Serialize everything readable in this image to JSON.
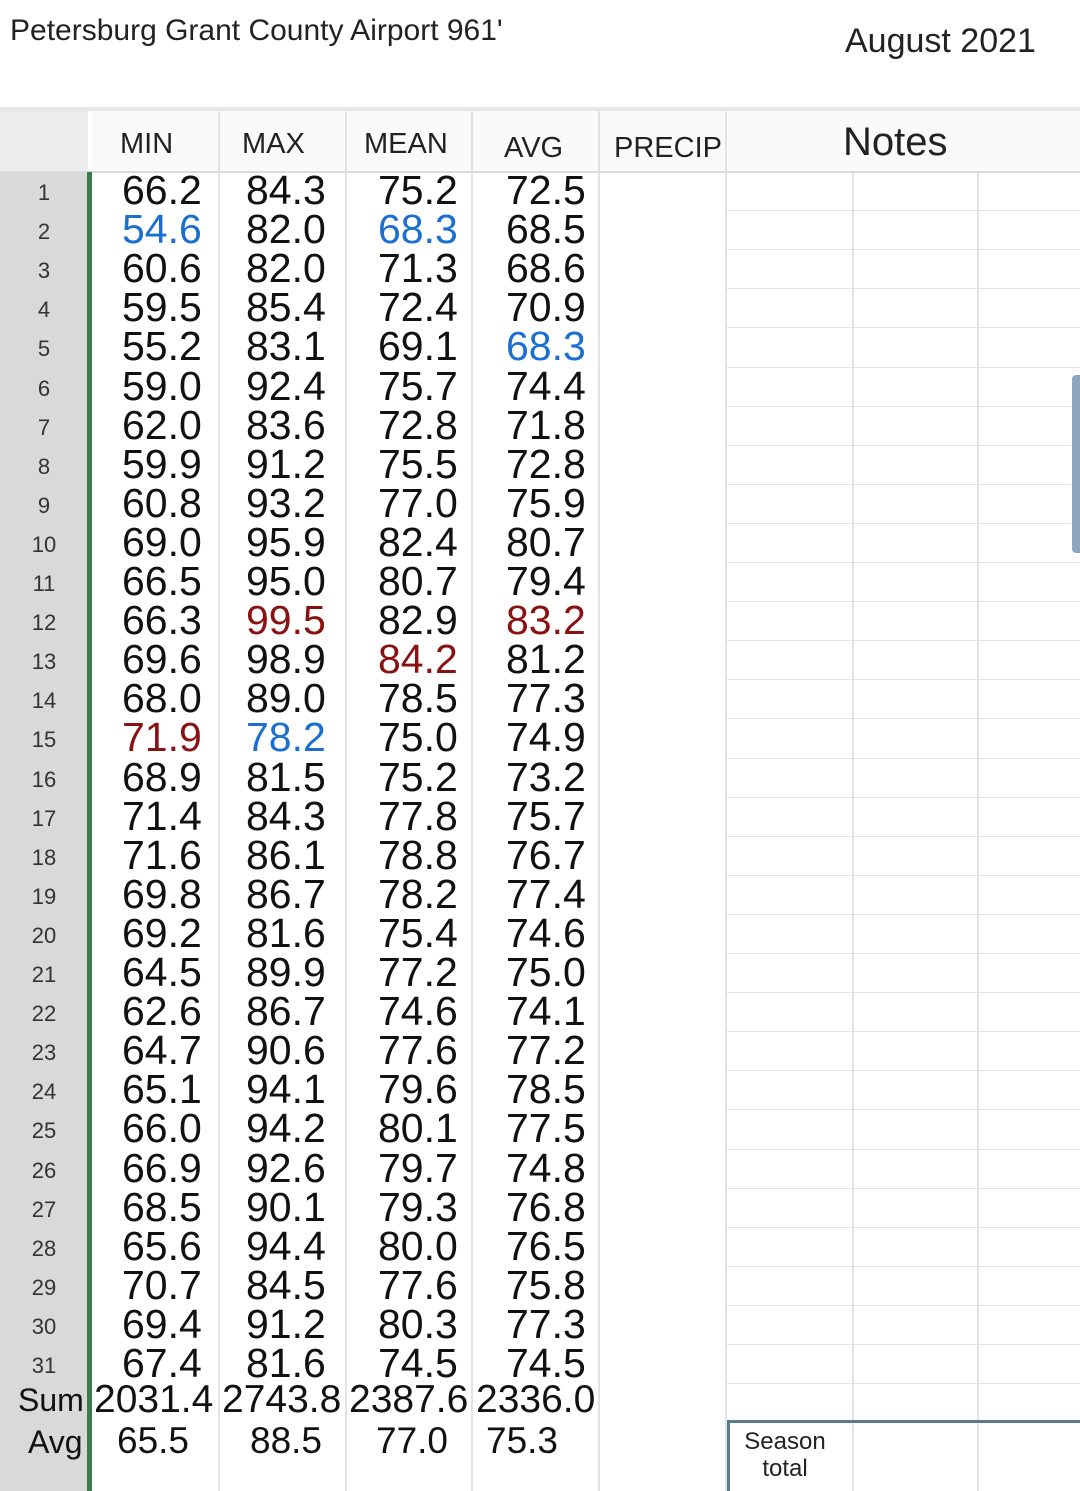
{
  "header": {
    "title": "Petersburg Grant County Airport 961'",
    "period": "August 2021"
  },
  "columns": {
    "min": "MIN",
    "max": "MAX",
    "mean": "MEAN",
    "avg": "AVG",
    "precip": "PRECIP",
    "notes": "Notes"
  },
  "highlight_colors": {
    "low": "#1a6fd1",
    "high": "#8a1111"
  },
  "rows": [
    {
      "day": "1",
      "min": "66.2",
      "max": "84.3",
      "mean": "75.2",
      "avg": "72.5"
    },
    {
      "day": "2",
      "min": "54.6",
      "max": "82.0",
      "mean": "68.3",
      "avg": "68.5",
      "hl": {
        "min": "low",
        "mean": "low"
      }
    },
    {
      "day": "3",
      "min": "60.6",
      "max": "82.0",
      "mean": "71.3",
      "avg": "68.6"
    },
    {
      "day": "4",
      "min": "59.5",
      "max": "85.4",
      "mean": "72.4",
      "avg": "70.9"
    },
    {
      "day": "5",
      "min": "55.2",
      "max": "83.1",
      "mean": "69.1",
      "avg": "68.3",
      "hl": {
        "avg": "low"
      }
    },
    {
      "day": "6",
      "min": "59.0",
      "max": "92.4",
      "mean": "75.7",
      "avg": "74.4"
    },
    {
      "day": "7",
      "min": "62.0",
      "max": "83.6",
      "mean": "72.8",
      "avg": "71.8"
    },
    {
      "day": "8",
      "min": "59.9",
      "max": "91.2",
      "mean": "75.5",
      "avg": "72.8"
    },
    {
      "day": "9",
      "min": "60.8",
      "max": "93.2",
      "mean": "77.0",
      "avg": "75.9"
    },
    {
      "day": "10",
      "min": "69.0",
      "max": "95.9",
      "mean": "82.4",
      "avg": "80.7"
    },
    {
      "day": "11",
      "min": "66.5",
      "max": "95.0",
      "mean": "80.7",
      "avg": "79.4"
    },
    {
      "day": "12",
      "min": "66.3",
      "max": "99.5",
      "mean": "82.9",
      "avg": "83.2",
      "hl": {
        "max": "high",
        "avg": "high"
      }
    },
    {
      "day": "13",
      "min": "69.6",
      "max": "98.9",
      "mean": "84.2",
      "avg": "81.2",
      "hl": {
        "mean": "high"
      }
    },
    {
      "day": "14",
      "min": "68.0",
      "max": "89.0",
      "mean": "78.5",
      "avg": "77.3"
    },
    {
      "day": "15",
      "min": "71.9",
      "max": "78.2",
      "mean": "75.0",
      "avg": "74.9",
      "hl": {
        "min": "high",
        "max": "low"
      }
    },
    {
      "day": "16",
      "min": "68.9",
      "max": "81.5",
      "mean": "75.2",
      "avg": "73.2"
    },
    {
      "day": "17",
      "min": "71.4",
      "max": "84.3",
      "mean": "77.8",
      "avg": "75.7"
    },
    {
      "day": "18",
      "min": "71.6",
      "max": "86.1",
      "mean": "78.8",
      "avg": "76.7"
    },
    {
      "day": "19",
      "min": "69.8",
      "max": "86.7",
      "mean": "78.2",
      "avg": "77.4"
    },
    {
      "day": "20",
      "min": "69.2",
      "max": "81.6",
      "mean": "75.4",
      "avg": "74.6"
    },
    {
      "day": "21",
      "min": "64.5",
      "max": "89.9",
      "mean": "77.2",
      "avg": "75.0"
    },
    {
      "day": "22",
      "min": "62.6",
      "max": "86.7",
      "mean": "74.6",
      "avg": "74.1"
    },
    {
      "day": "23",
      "min": "64.7",
      "max": "90.6",
      "mean": "77.6",
      "avg": "77.2"
    },
    {
      "day": "24",
      "min": "65.1",
      "max": "94.1",
      "mean": "79.6",
      "avg": "78.5"
    },
    {
      "day": "25",
      "min": "66.0",
      "max": "94.2",
      "mean": "80.1",
      "avg": "77.5"
    },
    {
      "day": "26",
      "min": "66.9",
      "max": "92.6",
      "mean": "79.7",
      "avg": "74.8"
    },
    {
      "day": "27",
      "min": "68.5",
      "max": "90.1",
      "mean": "79.3",
      "avg": "76.8"
    },
    {
      "day": "28",
      "min": "65.6",
      "max": "94.4",
      "mean": "80.0",
      "avg": "76.5"
    },
    {
      "day": "29",
      "min": "70.7",
      "max": "84.5",
      "mean": "77.6",
      "avg": "75.8"
    },
    {
      "day": "30",
      "min": "69.4",
      "max": "91.2",
      "mean": "80.3",
      "avg": "77.3"
    },
    {
      "day": "31",
      "min": "67.4",
      "max": "81.6",
      "mean": "74.5",
      "avg": "74.5"
    }
  ],
  "sum": {
    "label": "Sum",
    "min": "2031.4",
    "max": "2743.8",
    "mean": "2387.6",
    "avg": "2336.0"
  },
  "avg": {
    "label": "Avg",
    "min": "65.5",
    "max": "88.5",
    "mean": "77.0",
    "avg": "75.3"
  },
  "season": {
    "label": "Season total"
  }
}
